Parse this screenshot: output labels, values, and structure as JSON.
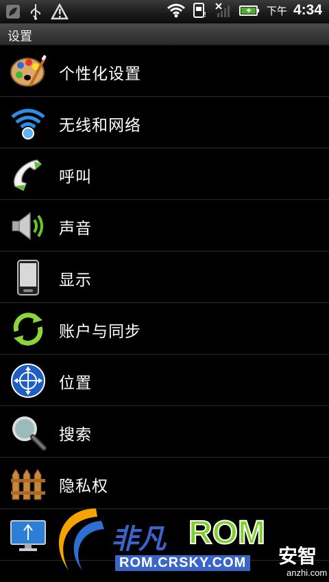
{
  "status_bar": {
    "icons_left": [
      "notification-leaf-icon",
      "usb-icon",
      "warning-icon"
    ],
    "icons_right": [
      "wifi-icon",
      "sim-icon",
      "signal-off-icon",
      "battery-charging-icon"
    ],
    "time_label": "下午",
    "time": "4:34"
  },
  "title": "设置",
  "settings": [
    {
      "label": "个性化设置",
      "icon": "palette-icon"
    },
    {
      "label": "无线和网络",
      "icon": "wireless-icon"
    },
    {
      "label": "呼叫",
      "icon": "phone-icon"
    },
    {
      "label": "声音",
      "icon": "speaker-icon"
    },
    {
      "label": "显示",
      "icon": "display-phone-icon"
    },
    {
      "label": "账户与同步",
      "icon": "sync-icon"
    },
    {
      "label": "位置",
      "icon": "location-globe-icon"
    },
    {
      "label": "搜索",
      "icon": "search-icon"
    },
    {
      "label": "隐私权",
      "icon": "fence-icon"
    },
    {
      "label": "",
      "icon": "usb-monitor-icon"
    }
  ],
  "watermark": {
    "brand": "非凡",
    "rom": "ROM",
    "url": "ROM.CRSKY.COM",
    "anzhi": "安智",
    "anzhi_url": "anzhi.com"
  },
  "colors": {
    "background": "#000000",
    "divider": "#2c2c2c",
    "accent_blue": "#2e8ee6",
    "accent_green": "#7fd02a"
  }
}
